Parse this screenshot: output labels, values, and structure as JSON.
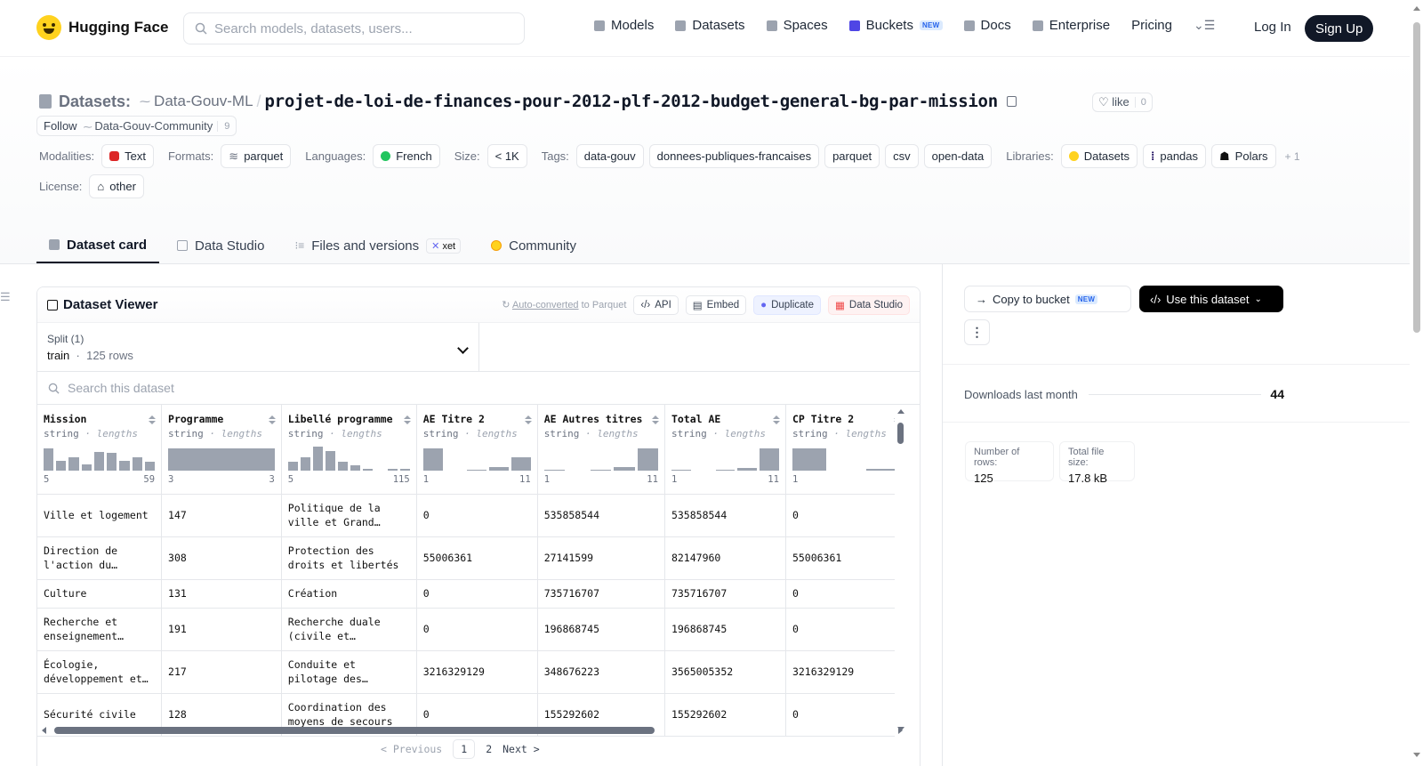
{
  "nav": {
    "brand": "Hugging Face",
    "search_placeholder": "Search models, datasets, users...",
    "links": [
      {
        "label": "Models",
        "icon": "models-icon"
      },
      {
        "label": "Datasets",
        "icon": "datasets-icon"
      },
      {
        "label": "Spaces",
        "icon": "spaces-icon"
      },
      {
        "label": "Buckets",
        "icon": "buckets-icon",
        "badge": "NEW"
      },
      {
        "label": "Docs",
        "icon": "docs-icon"
      },
      {
        "label": "Enterprise",
        "icon": "enterprise-icon"
      },
      {
        "label": "Pricing"
      }
    ],
    "login": "Log In",
    "signup": "Sign Up"
  },
  "header": {
    "section_label": "Datasets:",
    "owner": "Data-Gouv-ML",
    "separator": "/",
    "repo": "projet-de-loi-de-finances-pour-2012-plf-2012-budget-general-bg-par-mission",
    "like_label": "like",
    "like_count": "0",
    "follow_label": "Follow",
    "follow_org": "Data-Gouv-Community",
    "follow_count": "9"
  },
  "meta": {
    "modalities_label": "Modalities:",
    "modalities": [
      "Text"
    ],
    "formats_label": "Formats:",
    "formats": [
      "parquet"
    ],
    "languages_label": "Languages:",
    "languages": [
      "French"
    ],
    "size_label": "Size:",
    "size": "< 1K",
    "tags_label": "Tags:",
    "tags": [
      "data-gouv",
      "donnees-publiques-francaises",
      "parquet",
      "csv",
      "open-data"
    ],
    "libraries_label": "Libraries:",
    "libraries": [
      "Datasets",
      "pandas",
      "Polars"
    ],
    "libraries_more": "+ 1",
    "license_label": "License:",
    "license": "other"
  },
  "tabs": [
    {
      "label": "Dataset card",
      "active": true
    },
    {
      "label": "Data Studio"
    },
    {
      "label": "Files and versions",
      "badge": "xet"
    },
    {
      "label": "Community"
    }
  ],
  "viewer": {
    "title": "Dataset Viewer",
    "autoconverted_link": "Auto-converted",
    "autoconverted_rest": " to Parquet",
    "buttons": {
      "api": "API",
      "embed": "Embed",
      "duplicate": "Duplicate",
      "studio": "Data Studio"
    },
    "split_label": "Split (1)",
    "split_name": "train",
    "split_rows": "125 rows",
    "search_placeholder": "Search this dataset",
    "columns": [
      {
        "name": "Mission",
        "type": "string",
        "stat": "lengths",
        "min": "5",
        "max": "59",
        "hist": [
          0.9,
          0.4,
          0.55,
          0.25,
          0.75,
          0.7,
          0.4,
          0.55,
          0.35
        ]
      },
      {
        "name": "Programme",
        "type": "string",
        "stat": "lengths",
        "min": "3",
        "max": "3",
        "hist": [
          0.9
        ]
      },
      {
        "name": "Libellé programme",
        "type": "string",
        "stat": "lengths",
        "min": "5",
        "max": "115",
        "hist": [
          0.35,
          0.55,
          0.95,
          0.8,
          0.35,
          0.2,
          0.06,
          0,
          0.06,
          0.06
        ]
      },
      {
        "name": "AE Titre 2",
        "type": "string",
        "stat": "lengths",
        "min": "1",
        "max": "11",
        "hist": [
          0.9,
          0,
          0.04,
          0.15,
          0.55
        ]
      },
      {
        "name": "AE Autres titres",
        "type": "string",
        "stat": "lengths",
        "min": "1",
        "max": "11",
        "hist": [
          0.04,
          0,
          0.04,
          0.15,
          0.9
        ]
      },
      {
        "name": "Total AE",
        "type": "string",
        "stat": "lengths",
        "min": "1",
        "max": "11",
        "hist": [
          0.04,
          0,
          0.04,
          0.1,
          0.9
        ]
      },
      {
        "name": "CP Titre 2",
        "type": "string",
        "stat": "lengths",
        "min": "1",
        "max": "",
        "hist": [
          0.9,
          0,
          0.06
        ]
      }
    ],
    "rows": [
      [
        "Ville et logement",
        "147",
        "Politique de la ville et Grand…",
        "0",
        "535858544",
        "535858544",
        "0"
      ],
      [
        "Direction de l'action du…",
        "308",
        "Protection des droits et libertés",
        "55006361",
        "27141599",
        "82147960",
        "55006361"
      ],
      [
        "Culture",
        "131",
        "Création",
        "0",
        "735716707",
        "735716707",
        "0"
      ],
      [
        "Recherche et enseignement…",
        "191",
        "Recherche duale (civile et…",
        "0",
        "196868745",
        "196868745",
        "0"
      ],
      [
        "Écologie, développement et…",
        "217",
        "Conduite et pilotage des…",
        "3216329129",
        "348676223",
        "3565005352",
        "3216329129"
      ],
      [
        "Sécurité civile",
        "128",
        "Coordination des moyens de secours",
        "0",
        "155292602",
        "155292602",
        "0"
      ]
    ],
    "pager": {
      "prev": "< Previous",
      "pages": [
        "1",
        "2"
      ],
      "next": "Next >"
    }
  },
  "sidebar": {
    "copy_bucket": "Copy to bucket",
    "copy_bucket_badge": "NEW",
    "use_dataset": "Use this dataset",
    "downloads_label": "Downloads last month",
    "downloads_value": "44",
    "rows_label": "Number of rows:",
    "rows_value": "125",
    "size_label": "Total file size:",
    "size_value": "17.8 kB"
  }
}
